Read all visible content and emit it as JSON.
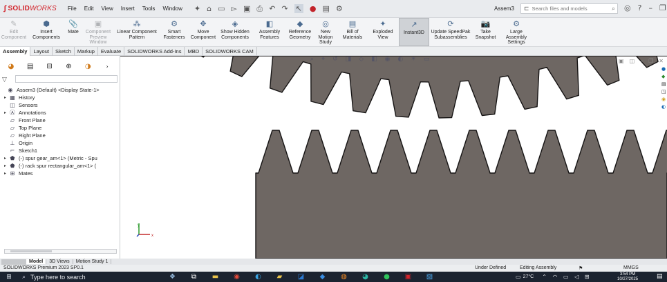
{
  "app": {
    "logo_prefix": "SOLID",
    "logo_suffix": "WORKS",
    "menu": [
      "File",
      "Edit",
      "View",
      "Insert",
      "Tools",
      "Window"
    ],
    "document_title": "Assem3",
    "search_placeholder": "Search files and models"
  },
  "ribbon": [
    {
      "id": "edit-component",
      "label": "Edit Component",
      "enabled": false,
      "icon": "edit-component-icon",
      "glyph": "✎"
    },
    {
      "id": "insert-components",
      "label": "Insert Components",
      "enabled": true,
      "icon": "insert-components-icon",
      "glyph": "⬢"
    },
    {
      "id": "mate",
      "label": "Mate",
      "enabled": true,
      "icon": "mate-icon",
      "glyph": "📎"
    },
    {
      "id": "component-preview-window",
      "label": "Component Preview Window",
      "enabled": false,
      "icon": "preview-window-icon",
      "glyph": "▣"
    },
    {
      "id": "linear-component-pattern",
      "label": "Linear Component Pattern",
      "enabled": true,
      "icon": "linear-pattern-icon",
      "glyph": "⁂"
    },
    {
      "id": "smart-fasteners",
      "label": "Smart Fasteners",
      "enabled": true,
      "icon": "smart-fasteners-icon",
      "glyph": "⚙"
    },
    {
      "id": "move-component",
      "label": "Move Component",
      "enabled": true,
      "icon": "move-component-icon",
      "glyph": "✥"
    },
    {
      "id": "show-hidden-components",
      "label": "Show Hidden Components",
      "enabled": true,
      "icon": "show-hidden-icon",
      "glyph": "◈"
    },
    {
      "id": "assembly-features",
      "label": "Assembly Features",
      "enabled": true,
      "icon": "assembly-features-icon",
      "glyph": "◧"
    },
    {
      "id": "reference-geometry",
      "label": "Reference Geometry",
      "enabled": true,
      "icon": "reference-geometry-icon",
      "glyph": "◆"
    },
    {
      "id": "new-motion-study",
      "label": "New Motion Study",
      "enabled": true,
      "icon": "motion-study-icon",
      "glyph": "◎"
    },
    {
      "id": "bill-of-materials",
      "label": "Bill of Materials",
      "enabled": true,
      "icon": "bom-icon",
      "glyph": "▤"
    },
    {
      "id": "exploded-view",
      "label": "Exploded View",
      "enabled": true,
      "icon": "exploded-view-icon",
      "glyph": "✦"
    },
    {
      "id": "instant3d",
      "label": "Instant3D",
      "enabled": true,
      "active": true,
      "icon": "instant3d-icon",
      "glyph": "↗"
    },
    {
      "id": "update-speedpak",
      "label": "Update SpeedPak Subassemblies",
      "enabled": true,
      "icon": "speedpak-icon",
      "glyph": "⟳"
    },
    {
      "id": "take-snapshot",
      "label": "Take Snapshot",
      "enabled": true,
      "icon": "snapshot-icon",
      "glyph": "📷"
    },
    {
      "id": "large-assembly-settings",
      "label": "Large Assembly Settings",
      "enabled": true,
      "icon": "large-assembly-icon",
      "glyph": "⚙"
    }
  ],
  "command_tabs": [
    "Assembly",
    "Layout",
    "Sketch",
    "Markup",
    "Evaluate",
    "SOLIDWORKS Add-Ins",
    "MBD",
    "SOLIDWORKS CAM"
  ],
  "active_command_tab": "Assembly",
  "tree": [
    {
      "label": "Assem3 (Default) <Display State-1>",
      "expander": "",
      "icon": "assembly-icon",
      "glyph": "◉",
      "indent": 0
    },
    {
      "label": "History",
      "expander": "▸",
      "icon": "history-icon",
      "glyph": "▦",
      "indent": 1
    },
    {
      "label": "Sensors",
      "expander": "",
      "icon": "sensors-icon",
      "glyph": "◫",
      "indent": 1
    },
    {
      "label": "Annotations",
      "expander": "▸",
      "icon": "annotations-icon",
      "glyph": "Ⓐ",
      "indent": 1
    },
    {
      "label": "Front Plane",
      "expander": "",
      "icon": "plane-icon",
      "glyph": "▱",
      "indent": 1
    },
    {
      "label": "Top Plane",
      "expander": "",
      "icon": "plane-icon",
      "glyph": "▱",
      "indent": 1
    },
    {
      "label": "Right Plane",
      "expander": "",
      "icon": "plane-icon",
      "glyph": "▱",
      "indent": 1
    },
    {
      "label": "Origin",
      "expander": "",
      "icon": "origin-icon",
      "glyph": "⊥",
      "indent": 1
    },
    {
      "label": "Sketch1",
      "expander": "",
      "icon": "sketch-icon",
      "glyph": "⌐",
      "indent": 1
    },
    {
      "label": "(-) spur gear_am<1> (Metric - Spu",
      "expander": "▸",
      "icon": "part-icon",
      "glyph": "⬟",
      "indent": 1
    },
    {
      "label": "(-) rack spur rectangular_am<1> (",
      "expander": "▸",
      "icon": "part-icon",
      "glyph": "⬟",
      "indent": 1
    },
    {
      "label": "Mates",
      "expander": "▸",
      "icon": "mates-icon",
      "glyph": "⊞",
      "indent": 1
    }
  ],
  "bottom_tabs": [
    "Model",
    "3D Views",
    "Motion Study 1"
  ],
  "active_bottom_tab": "Model",
  "status": {
    "product": "SOLIDWORKS Premium 2023 SP0.1",
    "definition": "Under Defined",
    "mode": "Editing Assembly",
    "units": "MMGS"
  },
  "taskbar": {
    "search_placeholder": "Type here to search",
    "weather": "27°C",
    "time": "3:54 PM",
    "date": "10/27/2025"
  },
  "colors": {
    "gear_fill": "#6e6763",
    "gear_stroke": "#161414",
    "brand_red": "#d2232a",
    "taskbar_bg": "#1b2330"
  }
}
